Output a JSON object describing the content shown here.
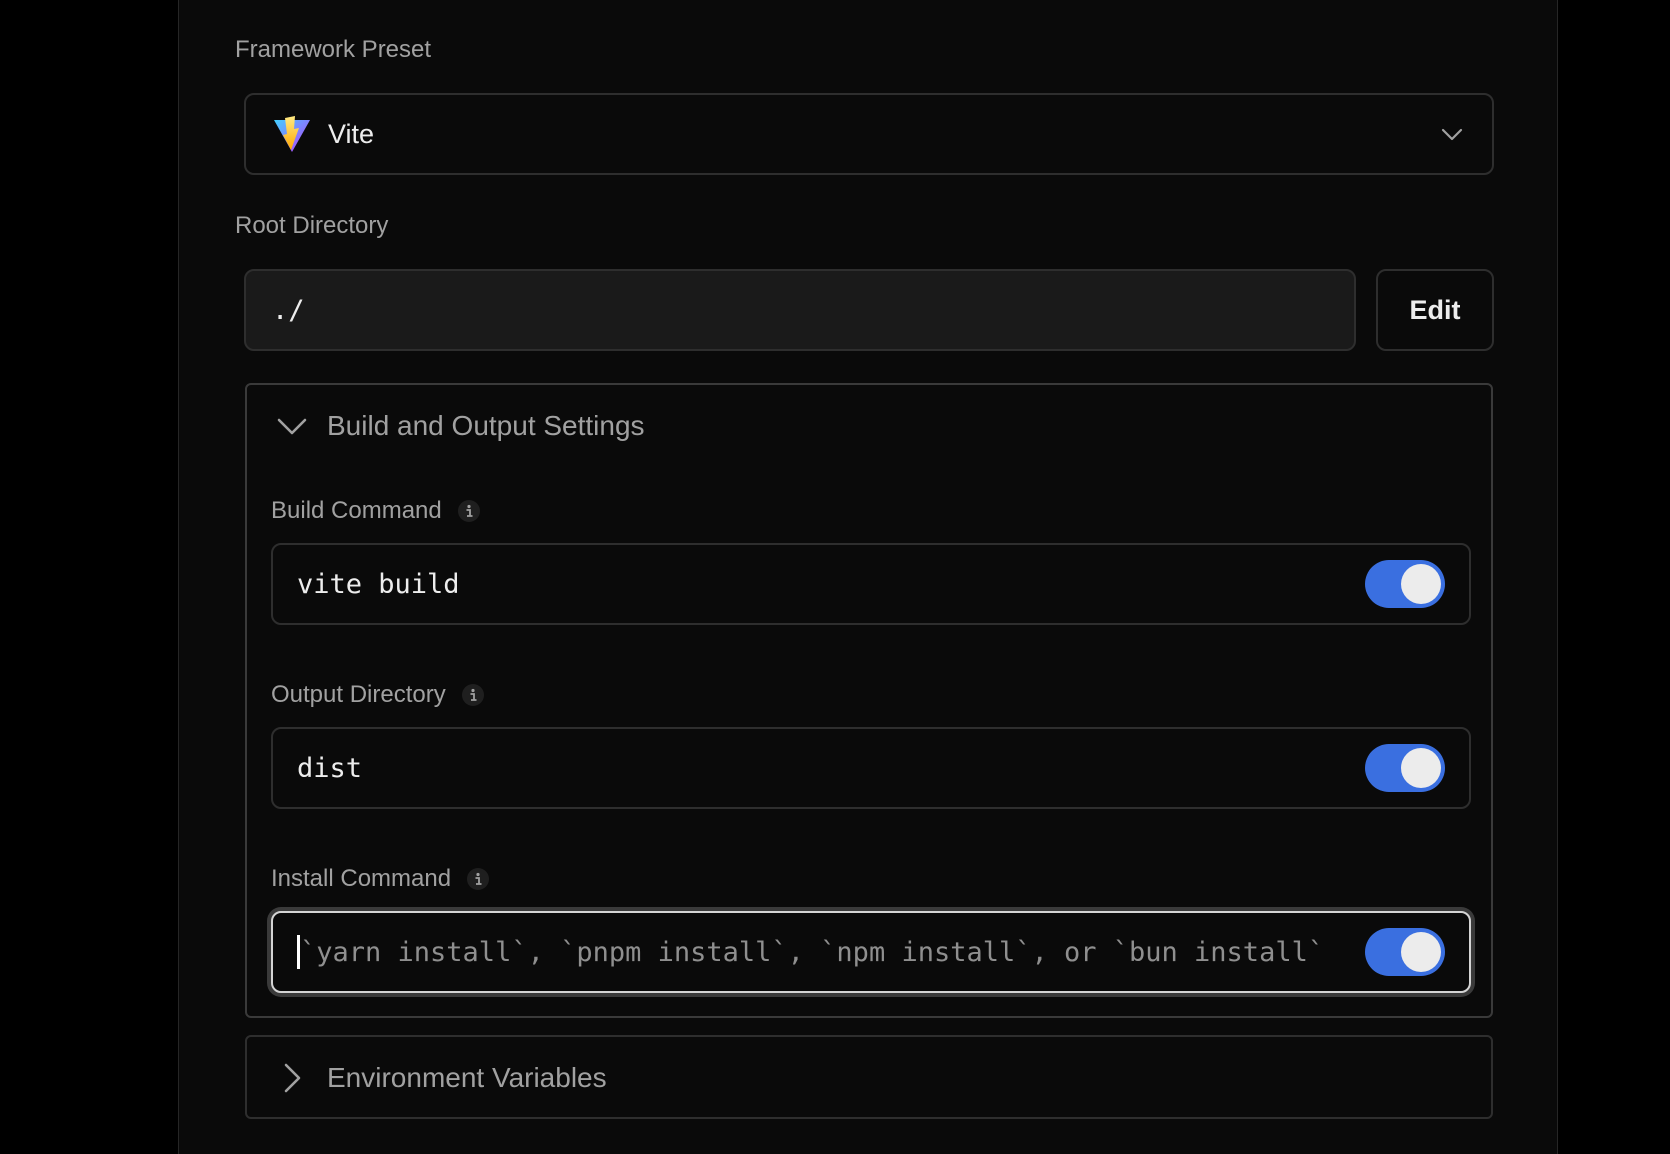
{
  "framework": {
    "label": "Framework Preset",
    "selected": "Vite",
    "icon": "vite-logo-icon"
  },
  "root": {
    "label": "Root Directory",
    "value": "./",
    "edit_label": "Edit"
  },
  "build_output": {
    "title": "Build and Output Settings",
    "expanded": true,
    "build_command": {
      "label": "Build Command",
      "value": "vite build",
      "override_enabled": true
    },
    "output_directory": {
      "label": "Output Directory",
      "value": "dist",
      "override_enabled": true
    },
    "install_command": {
      "label": "Install Command",
      "value": "",
      "placeholder": "`yarn install`, `pnpm install`, `npm install`, or `bun install`",
      "override_enabled": true
    }
  },
  "env_vars": {
    "title": "Environment Variables",
    "expanded": false
  },
  "colors": {
    "background": "#0a0a0a",
    "toggle_on": "#3a6fe0",
    "label": "#a1a1a1",
    "text": "#ededed"
  }
}
